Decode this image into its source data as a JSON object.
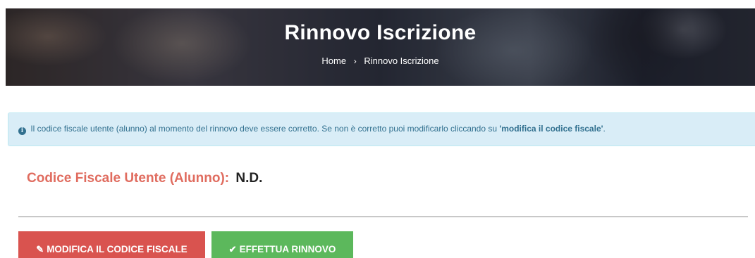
{
  "hero": {
    "title": "Rinnovo Iscrizione",
    "breadcrumb": {
      "home": "Home",
      "separator_icon": "chevron-right-icon",
      "current": "Rinnovo Iscrizione"
    }
  },
  "alert": {
    "icon": "info-circle-icon",
    "text": "Il codice fiscale utente (alunno) al momento del rinnovo deve essere corretto. Se non è corretto puoi modificarlo cliccando su ",
    "emphasis": "'modifica il codice fiscale'",
    "suffix": "."
  },
  "codice_fiscale": {
    "label": "Codice Fiscale Utente (Alunno):",
    "value": "N.D."
  },
  "buttons": {
    "modify": {
      "label": "MODIFICA IL CODICE FISCALE",
      "icon": "edit-icon",
      "color": "#d9534f"
    },
    "renew": {
      "label": "EFFETTUA RINNOVO",
      "icon": "check-icon",
      "color": "#5cb85c"
    }
  }
}
